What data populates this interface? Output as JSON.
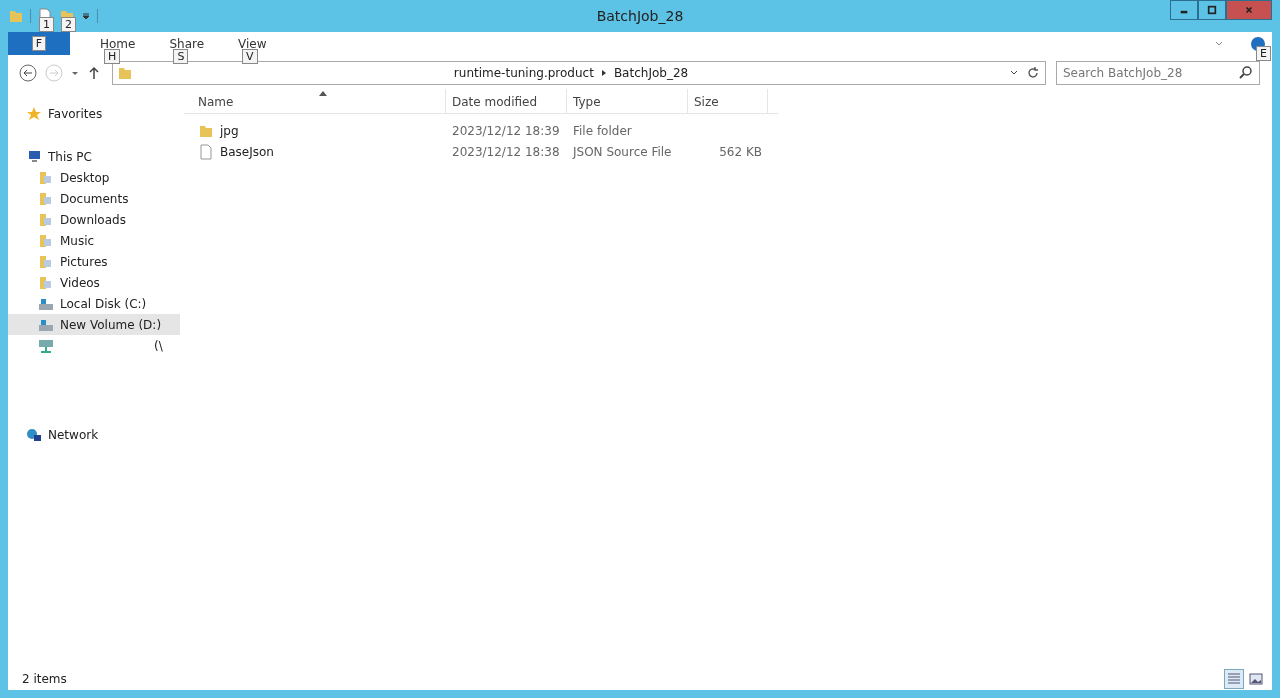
{
  "window": {
    "title": "BatchJob_28"
  },
  "quick_access": [
    {
      "key_tip": "1"
    },
    {
      "key_tip": "2"
    }
  ],
  "ribbon": {
    "file_tab": {
      "key_tip": "F"
    },
    "tabs": [
      {
        "label": "Home",
        "key_tip": "H",
        "selected": false
      },
      {
        "label": "Share",
        "key_tip": "S",
        "selected": false
      },
      {
        "label": "View",
        "key_tip": "V",
        "selected": false
      }
    ],
    "help_key_tip": "E"
  },
  "address_bar": {
    "path": [
      "runtime-tuning.product",
      "BatchJob_28"
    ]
  },
  "search": {
    "placeholder": "Search BatchJob_28"
  },
  "sidebar": {
    "items": [
      {
        "label": "Favorites",
        "kind": "favorites",
        "selected": false
      },
      {
        "label": "This PC",
        "kind": "pc",
        "selected": false,
        "children": [
          {
            "label": "Desktop",
            "kind": "folder",
            "selected": false
          },
          {
            "label": "Documents",
            "kind": "folder",
            "selected": false
          },
          {
            "label": "Downloads",
            "kind": "folder",
            "selected": false
          },
          {
            "label": "Music",
            "kind": "folder",
            "selected": false
          },
          {
            "label": "Pictures",
            "kind": "folder",
            "selected": false
          },
          {
            "label": "Videos",
            "kind": "folder",
            "selected": false
          },
          {
            "label": "Local Disk (C:)",
            "kind": "disk",
            "selected": false
          },
          {
            "label": "New Volume (D:)",
            "kind": "disk",
            "selected": true
          },
          {
            "label": "(\\",
            "kind": "netdrive",
            "selected": false
          }
        ]
      },
      {
        "label": "Network",
        "kind": "network",
        "selected": false
      }
    ]
  },
  "table": {
    "columns": [
      "Name",
      "Date modified",
      "Type",
      "Size"
    ],
    "rows": [
      {
        "name": "jpg",
        "kind": "folder",
        "date": "2023/12/12 18:39",
        "type": "File folder"
      },
      {
        "name": "BaseJson",
        "kind": "file",
        "date": "2023/12/12 18:38",
        "type": "JSON Source File",
        "size": "562 KB"
      }
    ]
  },
  "status_bar": {
    "items": "2 items"
  }
}
